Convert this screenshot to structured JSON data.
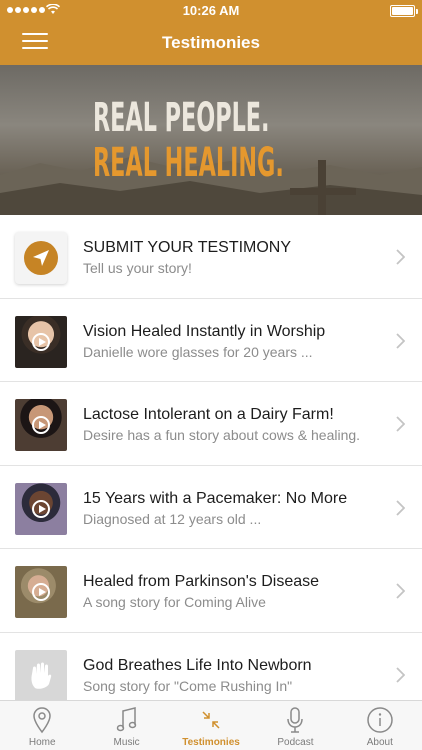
{
  "status_bar": {
    "time": "10:26 AM"
  },
  "header": {
    "title": "Testimonies"
  },
  "hero": {
    "line1": "REAL PEOPLE.",
    "line2": "REAL HEALING."
  },
  "list": {
    "items": [
      {
        "title": "SUBMIT YOUR TESTIMONY",
        "subtitle": "Tell us your story!",
        "thumb": "paper-plane-icon"
      },
      {
        "title": "Vision Healed Instantly in Worship",
        "subtitle": "Danielle wore glasses for 20 years ...",
        "thumb": "video-thumbnail"
      },
      {
        "title": "Lactose Intolerant on a Dairy Farm!",
        "subtitle": "Desire has a fun story about cows & healing.",
        "thumb": "video-thumbnail"
      },
      {
        "title": "15 Years with a Pacemaker: No More",
        "subtitle": "Diagnosed at 12 years old ...",
        "thumb": "video-thumbnail"
      },
      {
        "title": "Healed from Parkinson's Disease",
        "subtitle": "A song story for Coming Alive",
        "thumb": "video-thumbnail"
      },
      {
        "title": "God Breathes Life Into Newborn",
        "subtitle": "Song story for \"Come Rushing In\"",
        "thumb": "hand-icon"
      }
    ]
  },
  "tabbar": {
    "tabs": [
      {
        "label": "Home",
        "icon": "location-pin-icon"
      },
      {
        "label": "Music",
        "icon": "music-note-icon"
      },
      {
        "label": "Testimonies",
        "icon": "arrows-inward-icon",
        "active": true
      },
      {
        "label": "Podcast",
        "icon": "microphone-icon"
      },
      {
        "label": "About",
        "icon": "info-icon"
      }
    ]
  },
  "colors": {
    "accent": "#d0902f",
    "hero_orange": "#e5982e",
    "subtitle_gray": "#8c8c8c"
  }
}
